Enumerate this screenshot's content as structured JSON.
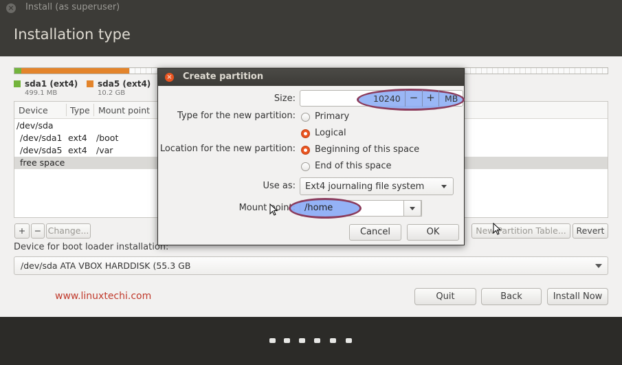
{
  "window": {
    "title": "Install (as superuser)",
    "header": "Installation type"
  },
  "partitions_legend": [
    {
      "name": "sda1 (ext4)",
      "size": "499.1 MB",
      "color": "#73b43c"
    },
    {
      "name": "sda5 (ext4)",
      "size": "10.2 GB",
      "color": "#e3842b"
    }
  ],
  "table": {
    "headers": [
      "Device",
      "Type",
      "Mount point"
    ],
    "rows": [
      {
        "device": "/dev/sda",
        "type": "",
        "mount": ""
      },
      {
        "device": "/dev/sda1",
        "type": "ext4",
        "mount": "/boot"
      },
      {
        "device": "/dev/sda5",
        "type": "ext4",
        "mount": "/var"
      },
      {
        "device": "free space",
        "type": "",
        "mount": ""
      }
    ]
  },
  "table_buttons": {
    "add": "+",
    "remove": "−",
    "change": "Change...",
    "new_table": "New Partition Table...",
    "revert": "Revert"
  },
  "bootloader": {
    "label": "Device for boot loader installation:",
    "value": "/dev/sda    ATA VBOX HARDDISK (55.3 GB"
  },
  "watermark": "www.linuxtechi.com",
  "nav_buttons": {
    "quit": "Quit",
    "back": "Back",
    "install": "Install Now"
  },
  "dialog": {
    "title": "Create partition",
    "size_label": "Size:",
    "size_value": "10240",
    "size_minus": "−",
    "size_plus": "+",
    "size_unit": "MB",
    "type_label": "Type for the new partition:",
    "type_primary": "Primary",
    "type_logical": "Logical",
    "type_selected": "Logical",
    "location_label": "Location for the new partition:",
    "location_begin": "Beginning of this space",
    "location_end": "End of this space",
    "location_selected": "Beginning of this space",
    "useas_label": "Use as:",
    "useas_value": "Ext4 journaling file system",
    "mount_label": "Mount point:",
    "mount_value": "/home",
    "cancel": "Cancel",
    "ok": "OK"
  },
  "colors": {
    "accent": "#e95420",
    "highlight": "#88aaf5",
    "highlight_border": "#8b3c5c"
  }
}
